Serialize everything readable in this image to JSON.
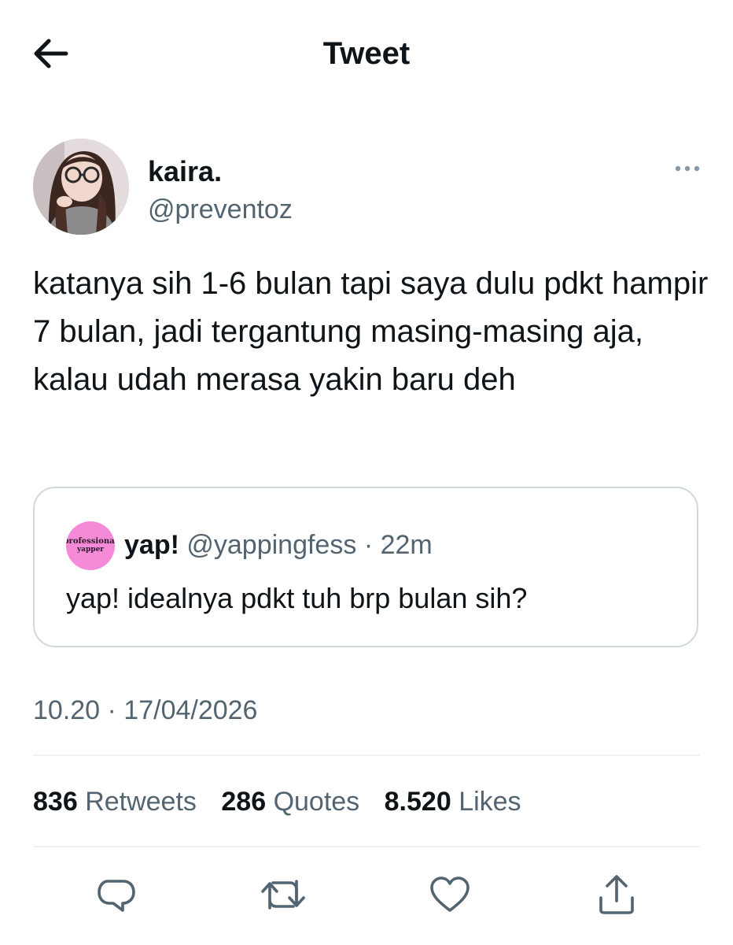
{
  "header": {
    "title": "Tweet",
    "back_icon": "arrow-left-icon"
  },
  "author": {
    "name": "kaira.",
    "handle": "@preventoz",
    "more_icon": "more-horizontal-icon"
  },
  "tweet": {
    "text": "katanya sih 1-6 bulan tapi saya dulu pdkt hampir 7 bulan, jadi tergantung masing-masing aja, kalau udah merasa yakin baru deh"
  },
  "quote": {
    "avatar_text_1": "professional",
    "avatar_text_2": "yapper",
    "name": "yap!",
    "handle": "@yappingfess",
    "separator": "·",
    "time": "22m",
    "text": "yap! idealnya pdkt tuh brp bulan sih?"
  },
  "timestamp": "10.20 · 17/04/2026",
  "stats": {
    "retweets_count": "836",
    "retweets_label": "Retweets",
    "quotes_count": "286",
    "quotes_label": "Quotes",
    "likes_count": "8.520",
    "likes_label": "Likes"
  },
  "actions": {
    "reply_icon": "reply-icon",
    "retweet_icon": "retweet-icon",
    "like_icon": "heart-icon",
    "share_icon": "share-icon"
  },
  "colors": {
    "text_primary": "#0f1419",
    "text_secondary": "#536471",
    "border": "#cfd9de",
    "divider": "#eff3f4",
    "quote_avatar_bg": "#f58bd8"
  }
}
